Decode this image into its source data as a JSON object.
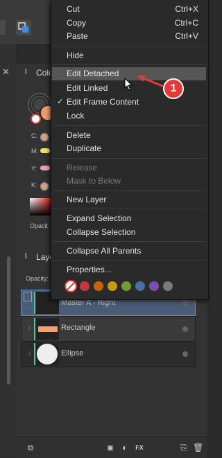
{
  "background": {
    "color_panel": {
      "tab_label": "Colo",
      "cmyk_labels": [
        "C:",
        "M:",
        "Y:",
        "K:"
      ],
      "opacity_label": "Opacit"
    },
    "layers_panel": {
      "tab_label": "Laye",
      "opacity_label": "Opacity:",
      "layers": [
        {
          "name": "Master A - Right",
          "selected": true
        },
        {
          "name": "Rectangle",
          "selected": false
        },
        {
          "name": "Ellipse",
          "selected": false
        }
      ]
    },
    "bottom_toolbar": {
      "icons": [
        "duplicate-icon",
        "mask-icon",
        "adjustment-icon",
        "fx-icon",
        "add-page-icon",
        "trash-icon"
      ],
      "fx_label": "FX"
    }
  },
  "context_menu": {
    "groups": [
      [
        {
          "label": "Cut",
          "shortcut": "Ctrl+X"
        },
        {
          "label": "Copy",
          "shortcut": "Ctrl+C"
        },
        {
          "label": "Paste",
          "shortcut": "Ctrl+V"
        }
      ],
      [
        {
          "label": "Hide"
        }
      ],
      [
        {
          "label": "Edit Detached",
          "highlighted": true
        },
        {
          "label": "Edit Linked"
        },
        {
          "label": "Edit Frame Content",
          "checked": true
        },
        {
          "label": "Lock"
        }
      ],
      [
        {
          "label": "Delete"
        },
        {
          "label": "Duplicate"
        }
      ],
      [
        {
          "label": "Release",
          "disabled": true
        },
        {
          "label": "Mask to Below",
          "disabled": true
        }
      ],
      [
        {
          "label": "New Layer"
        }
      ],
      [
        {
          "label": "Expand Selection"
        },
        {
          "label": "Collapse Selection"
        }
      ],
      [
        {
          "label": "Collapse All Parents"
        }
      ],
      [
        {
          "label": "Properties..."
        }
      ]
    ],
    "tag_colors": [
      "#c0393b",
      "#c8620e",
      "#c39a10",
      "#6e9e35",
      "#4a6fa5",
      "#7a4fb0",
      "#7a7a7a"
    ],
    "check_mark": "✓"
  },
  "annotation": {
    "badge_number": "1",
    "badge_color": "#e33a3a"
  }
}
